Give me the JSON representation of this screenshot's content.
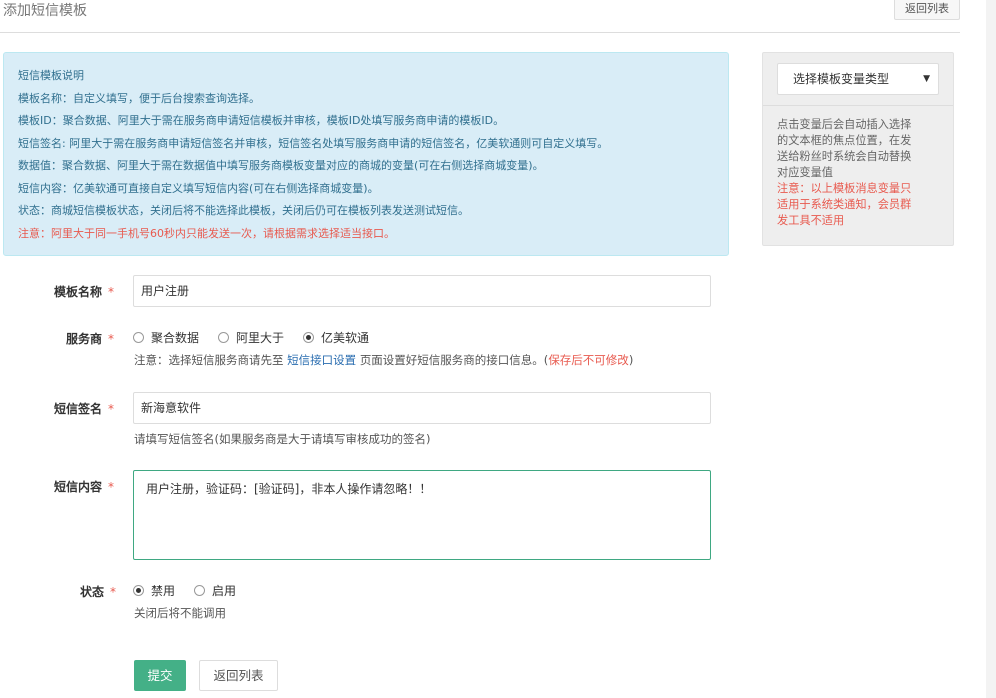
{
  "page": {
    "title": "添加短信模板",
    "back_label": "返回列表"
  },
  "info": {
    "heading": "短信模板说明",
    "lines": [
      "模板名称：自定义填写，便于后台搜索查询选择。",
      "模板ID：聚合数据、阿里大于需在服务商申请短信模板并审核，模板ID处填写服务商申请的模板ID。",
      "短信签名: 阿里大于需在服务商申请短信签名并审核，短信签名处填写服务商申请的短信签名，亿美软通则可自定义填写。",
      "数据值：聚合数据、阿里大于需在数据值中填写服务商模板变量对应的商城的变量(可在右侧选择商城变量)。",
      "短信内容：亿美软通可直接自定义填写短信内容(可在右侧选择商城变量)。",
      "状态：商城短信模板状态，关闭后将不能选择此模板，关闭后仍可在模板列表发送测试短信。"
    ],
    "warning": "注意：阿里大于同一手机号60秒内只能发送一次，请根据需求选择适当接口。"
  },
  "side": {
    "select_label": "选择模板变量类型",
    "caret": "▼",
    "desc_lines": [
      "点击变量后会自动插入选择",
      "的文本框的焦点位置，在发",
      "送给粉丝时系统会自动替换",
      "对应变量值"
    ],
    "warn_lines": [
      "注意：以上模板消息变量只",
      "适用于系统类通知，会员群",
      "发工具不适用"
    ]
  },
  "form": {
    "required_mark": "*",
    "name": {
      "label": "模板名称",
      "value": "用户注册"
    },
    "provider": {
      "label": "服务商",
      "options": [
        "聚合数据",
        "阿里大于",
        "亿美软通"
      ],
      "selected": 2,
      "help_prefix": "注意：选择短信服务商请先至",
      "help_link": "短信接口设置",
      "help_middle": "页面设置好短信服务商的接口信息。(",
      "help_warn": "保存后不可修改",
      "help_suffix": ")"
    },
    "signature": {
      "label": "短信签名",
      "value": "新海意软件",
      "help": "请填写短信签名(如果服务商是大于请填写审核成功的签名)"
    },
    "content": {
      "label": "短信内容",
      "value": "用户注册，验证码：[验证码]，非本人操作请忽略！！"
    },
    "status": {
      "label": "状态",
      "options": [
        "禁用",
        "启用"
      ],
      "selected": 0,
      "help": "关闭后将不能调用"
    },
    "submit_label": "提交",
    "back_label": "返回列表"
  }
}
